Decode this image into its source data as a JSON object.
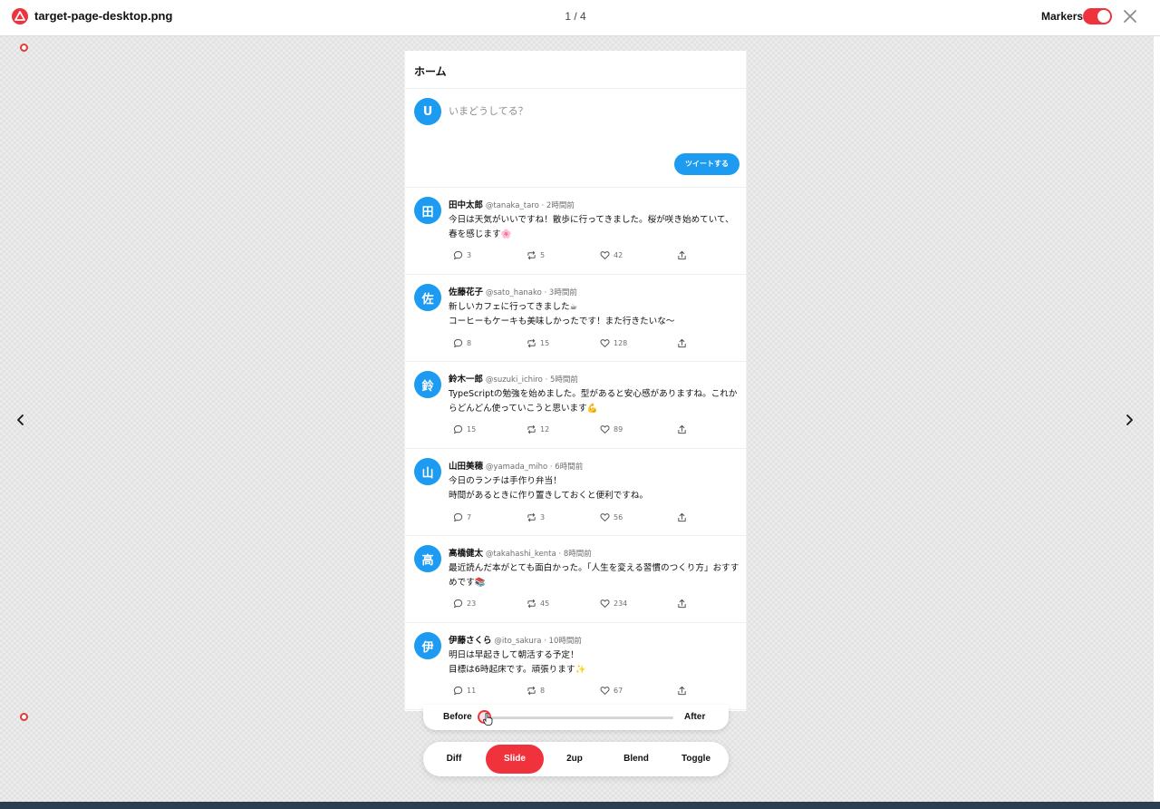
{
  "topbar": {
    "file_name": "target-page-desktop.png",
    "page_counter": "1 / 4",
    "markers_label": "Markers",
    "markers_enabled": true
  },
  "colors": {
    "accent": "#f0323c",
    "twitter_blue": "#1d9bf0"
  },
  "preview": {
    "header_title": "ホーム",
    "compose": {
      "avatar_initial": "U",
      "placeholder": "いまどうしてる？",
      "tweet_button": "ツイートする"
    },
    "posts": [
      {
        "avatar": "田",
        "name": "田中太郎",
        "meta": "@tanaka_taro · 2時間前",
        "text": "今日は天気がいいですね！散歩に行ってきました。桜が咲き始めていて、春を感じます🌸",
        "replies": "3",
        "retweets": "5",
        "likes": "42"
      },
      {
        "avatar": "佐",
        "name": "佐藤花子",
        "meta": "@sato_hanako · 3時間前",
        "text": "新しいカフェに行ってきました☕\nコーヒーもケーキも美味しかったです！また行きたいな〜",
        "replies": "8",
        "retweets": "15",
        "likes": "128"
      },
      {
        "avatar": "鈴",
        "name": "鈴木一郎",
        "meta": "@suzuki_ichiro · 5時間前",
        "text": "TypeScriptの勉強を始めました。型があると安心感がありますね。これからどんどん使っていこうと思います💪",
        "replies": "15",
        "retweets": "12",
        "likes": "89"
      },
      {
        "avatar": "山",
        "name": "山田美穂",
        "meta": "@yamada_miho · 6時間前",
        "text": "今日のランチは手作り弁当！\n時間があるときに作り置きしておくと便利ですね。",
        "replies": "7",
        "retweets": "3",
        "likes": "56"
      },
      {
        "avatar": "高",
        "name": "高橋健太",
        "meta": "@takahashi_kenta · 8時間前",
        "text": "最近読んだ本がとても面白かった。「人生を変える習慣のつくり方」おすすめです📚",
        "replies": "23",
        "retweets": "45",
        "likes": "234"
      },
      {
        "avatar": "伊",
        "name": "伊藤さくら",
        "meta": "@ito_sakura · 10時間前",
        "text": "明日は早起きして朝活する予定！\n目標は6時起床です。頑張ります✨",
        "replies": "11",
        "retweets": "8",
        "likes": "67"
      }
    ]
  },
  "slider": {
    "before_label": "Before",
    "after_label": "After",
    "position": 0.0
  },
  "modes": {
    "items": [
      "Diff",
      "Slide",
      "2up",
      "Blend",
      "Toggle"
    ],
    "active": "Slide"
  }
}
